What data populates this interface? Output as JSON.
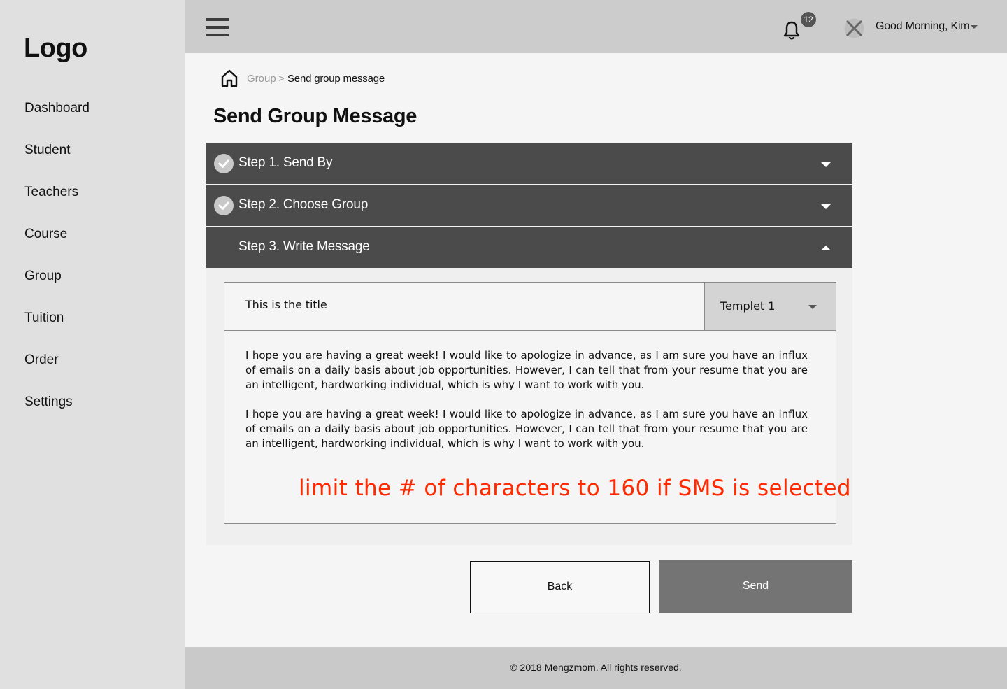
{
  "sidebar": {
    "logo": "Logo",
    "items": [
      {
        "label": "Dashboard"
      },
      {
        "label": "Student"
      },
      {
        "label": "Teachers"
      },
      {
        "label": "Course"
      },
      {
        "label": "Group"
      },
      {
        "label": "Tuition"
      },
      {
        "label": "Order"
      },
      {
        "label": "Settings"
      }
    ]
  },
  "header": {
    "menu_icon": "hamburger-menu-icon",
    "notifications": {
      "icon": "bell-icon",
      "count": "12"
    },
    "user": {
      "avatar_icon": "avatar-placeholder-icon",
      "greeting": "Good Morning, Kim"
    }
  },
  "breadcrumb": {
    "home_icon": "home-icon",
    "parent": "Group",
    "separator": ">",
    "current": "Send group message"
  },
  "page": {
    "title": "Send Group Message"
  },
  "steps": [
    {
      "label": "Step 1. Send By",
      "completed": true,
      "expanded": false
    },
    {
      "label": "Step 2. Choose Group",
      "completed": true,
      "expanded": false
    },
    {
      "label": "Step 3.  Write Message",
      "completed": false,
      "expanded": true
    }
  ],
  "message": {
    "title_value": "This is the title",
    "template_selected": "Templet 1",
    "body_paragraphs": [
      "I hope you are having a great week! I would like to apologize in advance, as I am sure you have an influx of emails on a daily basis about job opportunities. However, I can tell that from your resume that you are an intelligent, hardworking individual, which is why I want to work with you.",
      "I hope you are having a great week! I would like to apologize in advance, as I am sure you have an influx of emails on a daily basis about job opportunities. However, I can tell that from your resume that you are an intelligent, hardworking individual, which is why I want to work with you."
    ],
    "annotation": "limit the # of characters to 160 if SMS is selected"
  },
  "actions": {
    "back_label": "Back",
    "send_label": "Send"
  },
  "footer": {
    "text": "© 2018 Mengzmom. All rights reserved."
  },
  "colors": {
    "sidebar_bg": "#e0e0e0",
    "topbar_bg": "#cccccc",
    "step_header_bg": "#4b4b4b",
    "send_button_bg": "#747474",
    "annotation": "#ff2a00"
  }
}
